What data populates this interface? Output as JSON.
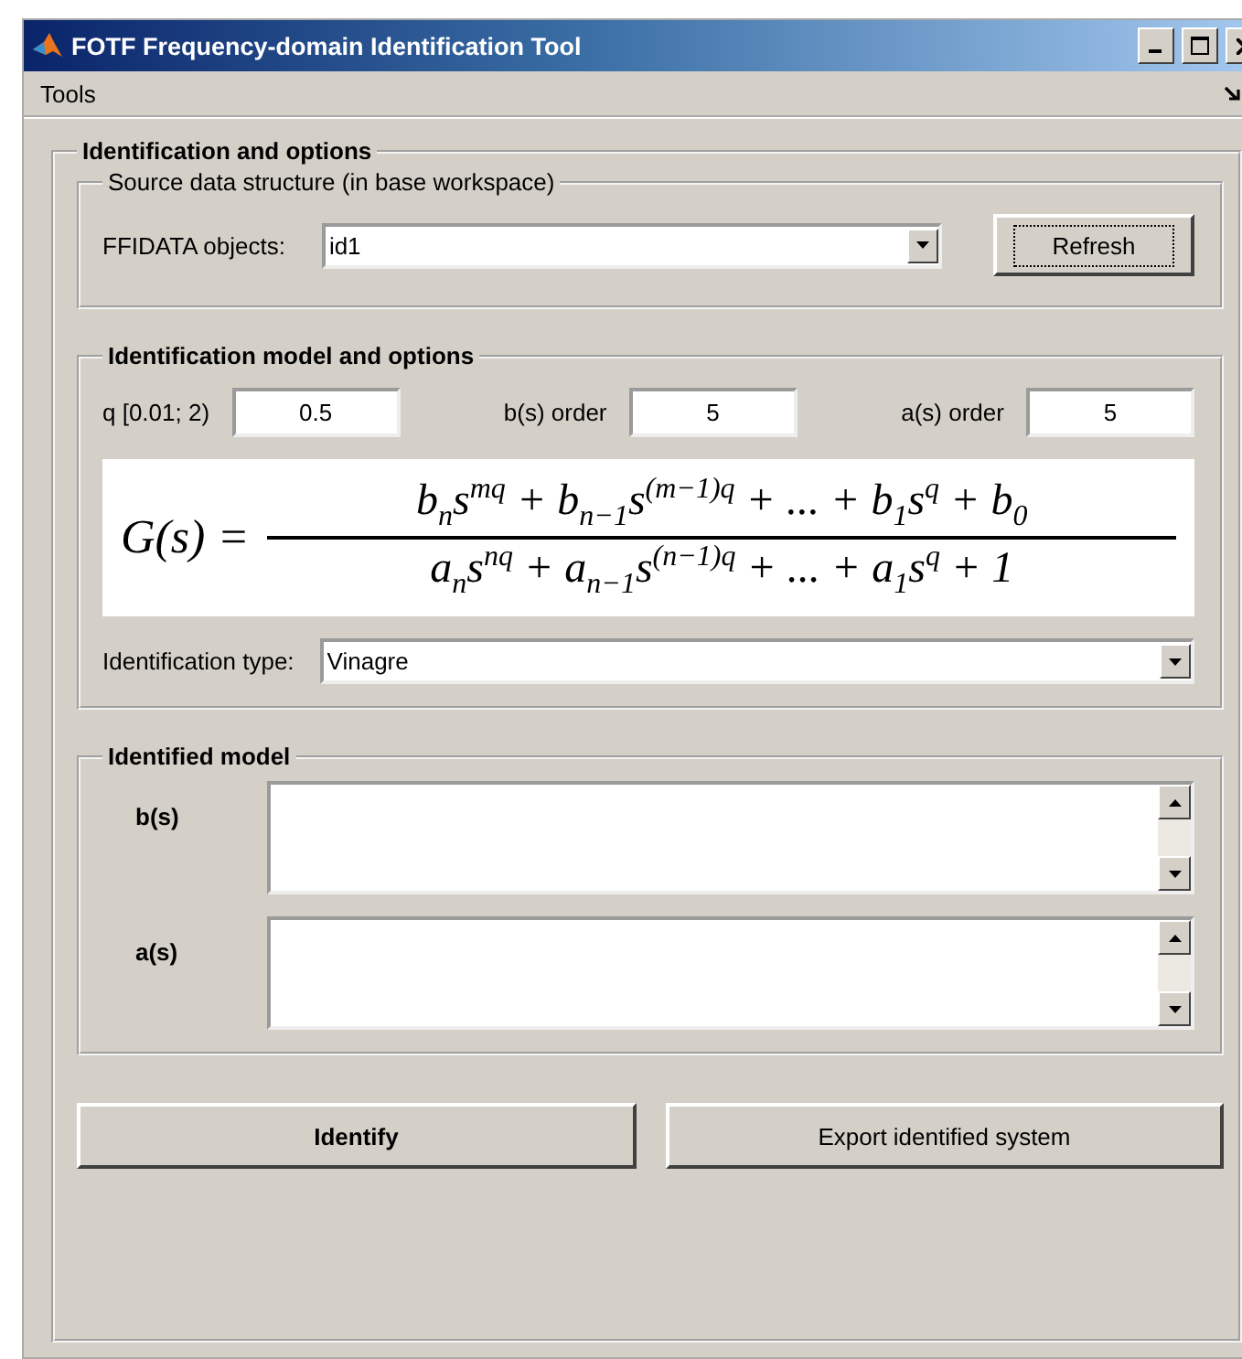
{
  "window": {
    "title": "FOTF Frequency-domain Identification Tool"
  },
  "menu": [
    {
      "label": "Tools"
    }
  ],
  "panel": {
    "title": "Identification and options"
  },
  "source": {
    "title": "Source data structure (in base workspace)",
    "label": "FFIDATA objects:",
    "value": "id1",
    "button": "Refresh",
    "button_focused": true
  },
  "model": {
    "title": "Identification model and options",
    "params": [
      {
        "label": "q [0.01; 2)",
        "value": "0.5"
      },
      {
        "label": "b(s) order",
        "value": "5"
      },
      {
        "label": "a(s) order",
        "value": "5"
      }
    ],
    "formula": {
      "lhs": "G(s) =",
      "numerator": "b$_{n}$s$^{mq}$ + b$_{n−1}$s$^{(m−1)q}$ + ... + b$_{1}$s$^{q}$ + b$_{0}$",
      "denominator": "a$_{n}$s$^{nq}$ + a$_{n−1}$s$^{(n−1)q}$ + ... + a$_{1}$s$^{q}$ + 1"
    },
    "type_label": "Identification type:",
    "type_value": "Vinagre"
  },
  "identified": {
    "title": "Identified model",
    "fields": [
      {
        "label": "b(s)"
      },
      {
        "label": "a(s)"
      }
    ]
  },
  "buttons": [
    {
      "label": "Identify",
      "bold": true
    },
    {
      "label": "Export identified system",
      "bold": false
    }
  ]
}
